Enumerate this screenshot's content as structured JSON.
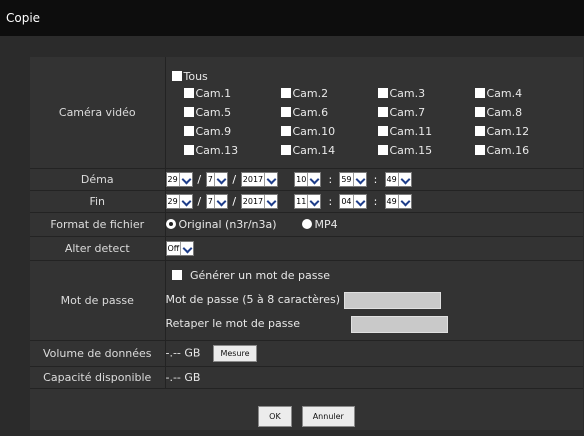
{
  "window": {
    "title": "Copie"
  },
  "camera": {
    "label": "Caméra vidéo",
    "all_label": "Tous",
    "cams": [
      "Cam.1",
      "Cam.2",
      "Cam.3",
      "Cam.4",
      "Cam.5",
      "Cam.6",
      "Cam.7",
      "Cam.8",
      "Cam.9",
      "Cam.10",
      "Cam.11",
      "Cam.12",
      "Cam.13",
      "Cam.14",
      "Cam.15",
      "Cam.16"
    ]
  },
  "start": {
    "label": "Déma",
    "day": "29",
    "month": "7",
    "year": "2017",
    "hour": "10",
    "minute": "59",
    "second": "49"
  },
  "end": {
    "label": "Fin",
    "day": "29",
    "month": "7",
    "year": "2017",
    "hour": "11",
    "minute": "04",
    "second": "49"
  },
  "separators": {
    "date": "/",
    "time": ":"
  },
  "format": {
    "label": "Format de fichier",
    "original": "Original (n3r/n3a)",
    "mp4": "MP4",
    "selected": "original"
  },
  "alter": {
    "label": "Alter detect",
    "value": "Off"
  },
  "password": {
    "label": "Mot de passe",
    "generate_label": "Générer un mot de passe",
    "password_label": "Mot de passe (5 à 8 caractères)",
    "retype_label": "Retaper le mot de passe"
  },
  "volume": {
    "label": "Volume de données",
    "value": "-.-- GB",
    "button": "Mesure"
  },
  "capacity": {
    "label": "Capacité disponible",
    "value": "-.-- GB"
  },
  "buttons": {
    "ok": "OK",
    "cancel": "Annuler"
  },
  "colors": {
    "titlebar": "#0d0d0d",
    "background": "#2b2b2b",
    "panel": "#333333",
    "arrow": "#1f3e8a"
  }
}
